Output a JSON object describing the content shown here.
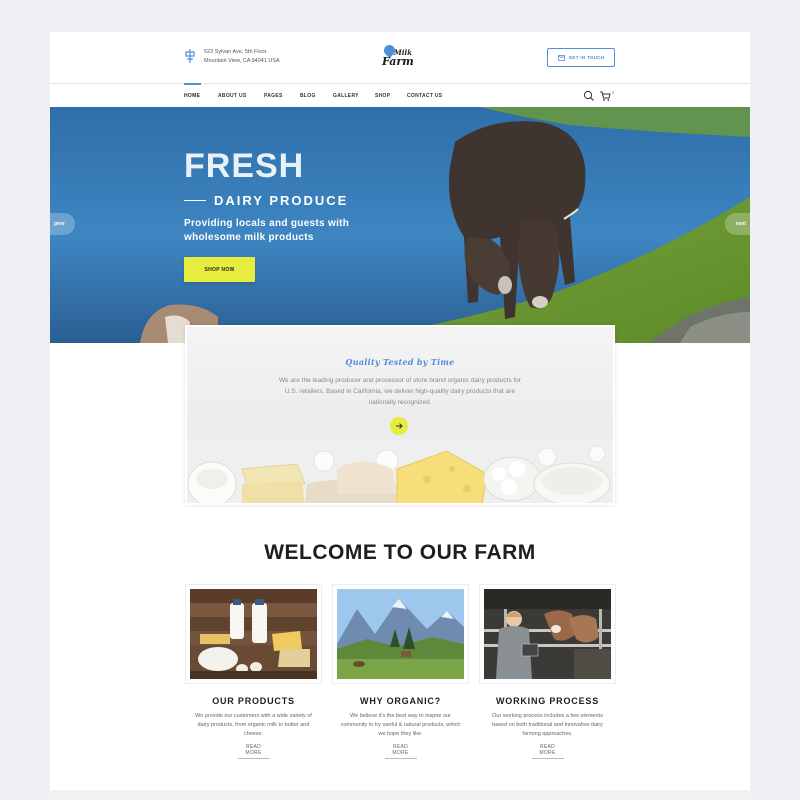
{
  "header": {
    "address_line1": "523 Sylvan Ave, 5th Floor",
    "address_line2": "Mountain View, CA 94041 USA",
    "logo_word1": "Milk",
    "logo_word2": "Farm",
    "get_in_touch": "GET IN TOUCH"
  },
  "nav": {
    "items": [
      {
        "label": "HOME",
        "active": true
      },
      {
        "label": "ABOUT US"
      },
      {
        "label": "PAGES"
      },
      {
        "label": "BLOG"
      },
      {
        "label": "GALLERY"
      },
      {
        "label": "SHOP"
      },
      {
        "label": "CONTACT US"
      }
    ],
    "cart_count": "0"
  },
  "hero": {
    "title": "FRESH",
    "subtitle": "DAIRY PRODUCE",
    "text": "Providing locals and guests with wholesome milk products",
    "button": "SHOP NOW",
    "prev": "prev",
    "next": "next"
  },
  "quality": {
    "title": "Quality Tested by Time",
    "text": "We are the leading producer and processor of store brand organic dairy products for U.S. retailers. Based in California, we deliver high-quality dairy products that are nationally recognized."
  },
  "welcome": {
    "title": "WELCOME TO OUR FARM",
    "features": [
      {
        "title": "OUR PRODUCTS",
        "text": "We provide our customers with a wide variety of dairy products, from organic milk to butter and cheese.",
        "more": "READ MORE"
      },
      {
        "title": "WHY ORGANIC?",
        "text": "We believe it's the best way to inspire our community to try useful & natural products, which we hope they like.",
        "more": "READ MORE"
      },
      {
        "title": "WORKING PROCESS",
        "text": "Our working process includes a few elements based on both traditional and innovative dairy farming approaches.",
        "more": "READ MORE"
      }
    ]
  },
  "colors": {
    "accent_blue": "#4e8ed8",
    "accent_yellow": "#e6ed3e"
  }
}
